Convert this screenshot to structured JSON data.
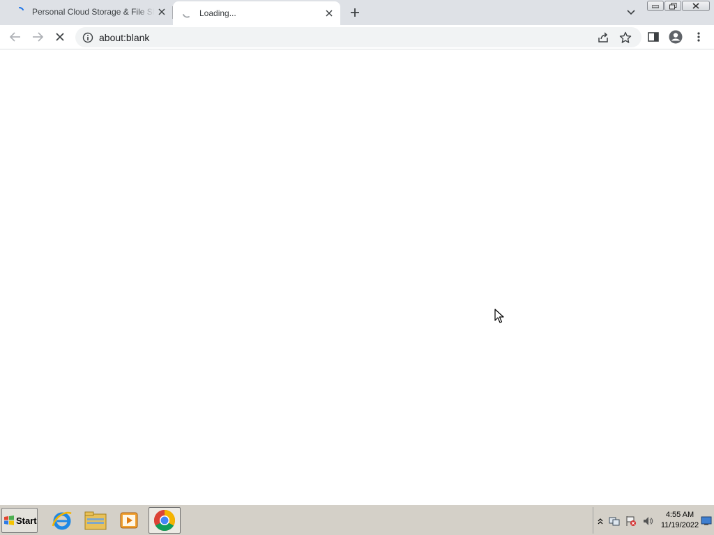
{
  "browser": {
    "tabs": [
      {
        "title": "Personal Cloud Storage & File Sharing",
        "state": "loading",
        "active": false
      },
      {
        "title": "Loading...",
        "state": "loading",
        "active": true
      }
    ],
    "address_bar": {
      "url": "about:blank"
    },
    "colors": {
      "tabstrip": "#dee1e6",
      "omnibox": "#f1f3f4",
      "spinner": "#1a73e8"
    }
  },
  "taskbar": {
    "start_label": "Start",
    "apps": [
      "internet-explorer-icon",
      "file-explorer-icon",
      "media-player-icon",
      "chrome-icon"
    ],
    "clock": {
      "time": "4:55 AM",
      "date": "11/19/2022"
    }
  }
}
